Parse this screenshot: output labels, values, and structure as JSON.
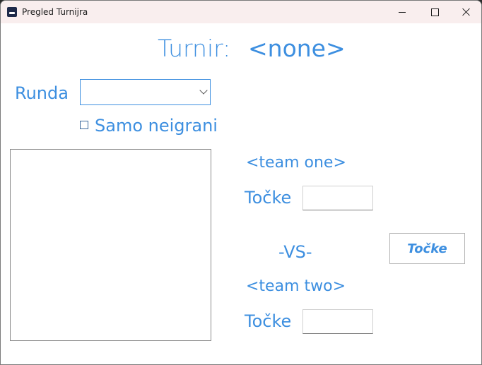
{
  "window": {
    "title": "Pregled Turnijra",
    "icon": "app-icon",
    "controls": {
      "minimize": "minimize-icon",
      "maximize": "maximize-icon",
      "close": "close-icon"
    }
  },
  "header": {
    "tournament_label": "Turnir:",
    "tournament_value": "<none>"
  },
  "round": {
    "label": "Runda",
    "selected_value": ""
  },
  "filter": {
    "unplayed_only_label": "Samo neigrani",
    "checked": false
  },
  "matchup_list": {
    "items": []
  },
  "match": {
    "team_one": "<team one>",
    "team_one_points_label": "Točke",
    "team_one_points_value": "",
    "versus": "-VS-",
    "team_two": "<team two>",
    "team_two_points_label": "Točke",
    "team_two_points_value": "",
    "submit_button": "Točke"
  },
  "colors": {
    "accent": "#3d8fe0",
    "titlebar": "#f9eeee"
  }
}
